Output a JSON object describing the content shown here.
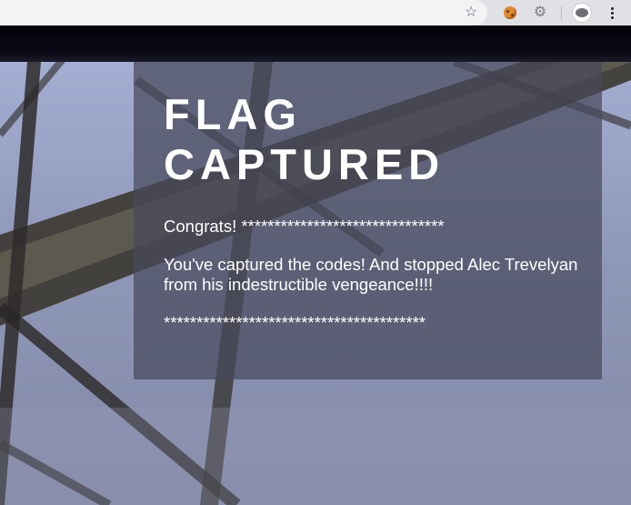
{
  "browser": {
    "toolbar_icons": [
      "star-icon",
      "cookie-extension-icon",
      "gear-extension-icon",
      "profile-avatar",
      "menu-icon"
    ],
    "colors": {
      "toolbar": "#dfe1e5",
      "omnibox": "#f1f3f4"
    }
  },
  "panel": {
    "title_line1": "FLAG",
    "title_line2": "CAPTURED",
    "congrats": "Congrats! *******************************",
    "message": "You've captured the codes! And stopped Alec Trevelyan from his indestructible vengeance!!!!",
    "stars": "****************************************"
  },
  "colors": {
    "panel_bg": "rgba(72,74,92,0.72)",
    "text": "#ffffff",
    "band": "#050308"
  }
}
